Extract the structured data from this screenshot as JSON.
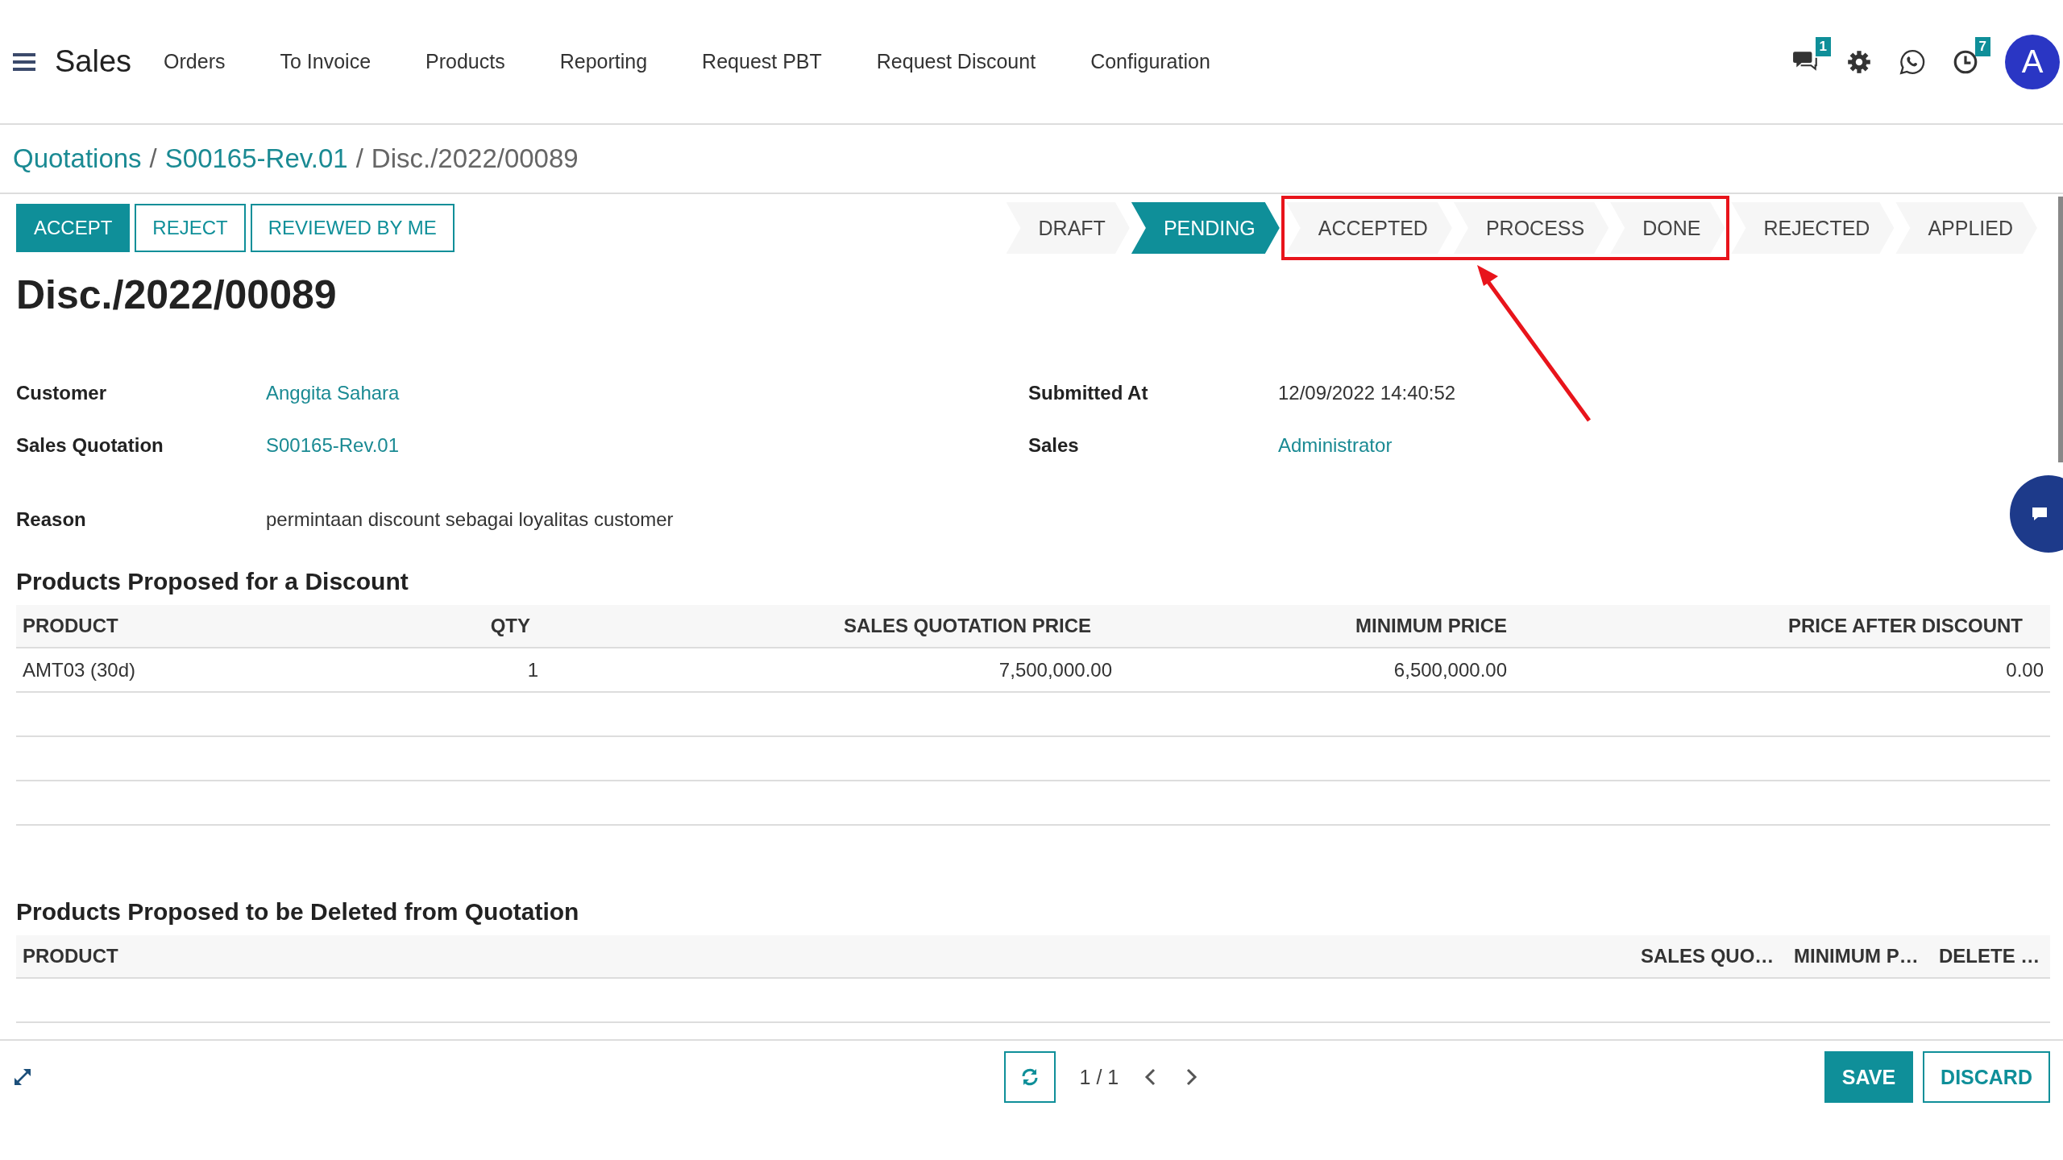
{
  "app": {
    "title": "Sales"
  },
  "menu": [
    {
      "label": "Orders"
    },
    {
      "label": "To Invoice"
    },
    {
      "label": "Products"
    },
    {
      "label": "Reporting"
    },
    {
      "label": "Request PBT"
    },
    {
      "label": "Request Discount"
    },
    {
      "label": "Configuration"
    }
  ],
  "systray": [
    {
      "kind": "messages",
      "badge": "1"
    },
    {
      "kind": "settings"
    },
    {
      "kind": "whatsapp"
    },
    {
      "kind": "activity",
      "badge": "7"
    }
  ],
  "user": {
    "initial": "A"
  },
  "breadcrumb": [
    {
      "label": "Quotations",
      "link": true
    },
    {
      "separator": "/",
      "label": "S00165-Rev.01",
      "link": true
    },
    {
      "separator": "/",
      "label": "Disc./2022/00089",
      "link": false
    }
  ],
  "actions": [
    {
      "label": "ACCEPT",
      "primary": true
    },
    {
      "label": "REJECT",
      "primary": false
    },
    {
      "label": "REVIEWED BY ME",
      "primary": false
    }
  ],
  "stages": [
    {
      "label": "DRAFT",
      "selected": false,
      "highlighted": false
    },
    {
      "label": "PENDING",
      "selected": true,
      "highlighted": false
    },
    {
      "label": "ACCEPTED",
      "selected": false,
      "highlighted": true
    },
    {
      "label": "PROCESS",
      "selected": false,
      "highlighted": true
    },
    {
      "label": "DONE",
      "selected": false,
      "highlighted": true
    },
    {
      "label": "REJECTED",
      "selected": false,
      "highlighted": false
    },
    {
      "label": "APPLIED",
      "selected": false,
      "highlighted": false
    }
  ],
  "record_title": "Disc./2022/00089",
  "fields_left": [
    {
      "label": "Customer",
      "value": "Anggita Sahara",
      "link": true
    },
    {
      "label": "Sales Quotation",
      "value": "S00165-Rev.01",
      "link": true
    }
  ],
  "fields_right": [
    {
      "label": "Submitted At",
      "value": "12/09/2022 14:40:52",
      "link": false
    },
    {
      "label": "Sales",
      "value": "Administrator",
      "link": true
    }
  ],
  "reason": {
    "label": "Reason",
    "value": "permintaan discount sebagai loyalitas customer"
  },
  "discount_table": {
    "title": "Products Proposed for a Discount",
    "columns": [
      "PRODUCT",
      "QTY",
      "SALES QUOTATION PRICE",
      "MINIMUM PRICE",
      "PRICE AFTER DISCOUNT"
    ],
    "rows": [
      [
        "AMT03 (30d)",
        "1",
        "7,500,000.00",
        "6,500,000.00",
        "0.00"
      ]
    ]
  },
  "delete_table": {
    "title": "Products Proposed to be Deleted from Quotation",
    "columns": [
      "PRODUCT",
      "SALES QUO…",
      "MINIMUM P…",
      "DELETE …"
    ]
  },
  "pager": {
    "value": "1 / 1"
  },
  "footer_buttons": [
    {
      "label": "SAVE",
      "primary": true
    },
    {
      "label": "DISCARD",
      "primary": false
    }
  ]
}
